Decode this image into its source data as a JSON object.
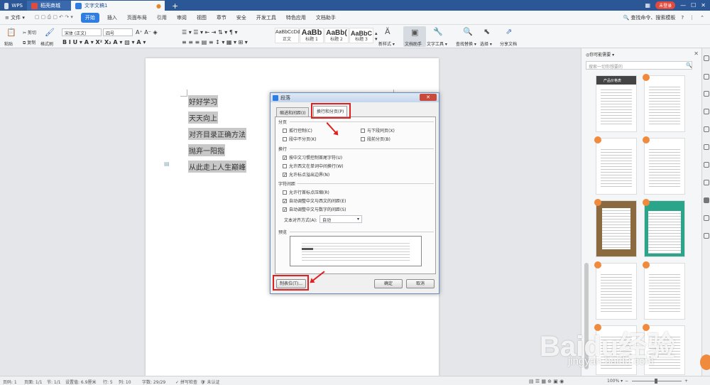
{
  "titlebar": {
    "tabs": [
      {
        "label": "WPS",
        "color": "#2b5797"
      },
      {
        "label": "稻壳商城",
        "color": "#e04b3d"
      },
      {
        "label": "文字文稿1",
        "color": "#2f7de1"
      }
    ],
    "login": "未登录"
  },
  "menubar": {
    "file": "文件",
    "items": [
      "开始",
      "插入",
      "页面布局",
      "引用",
      "审阅",
      "视图",
      "章节",
      "安全",
      "开发工具",
      "特色应用",
      "文档助手"
    ],
    "search": "查找命令、搜索模板"
  },
  "ribbon": {
    "paste": "粘贴",
    "cut": "剪切",
    "copy": "复制",
    "format_painter": "格式刷",
    "font": "宋体 (正文)",
    "size": "四号",
    "styles": [
      {
        "sample": "AaBbCcDd",
        "label": "正文"
      },
      {
        "sample": "AaBb",
        "label": "标题 1"
      },
      {
        "sample": "AaBb(",
        "label": "标题 2"
      },
      {
        "sample": "AaBbC",
        "label": "标题 3"
      }
    ],
    "new_style": "新样式",
    "doc_assistant": "文档助手",
    "text_tools": "文字工具",
    "find_replace": "查找替换",
    "select": "选择",
    "share": "分享文档"
  },
  "document": {
    "lines": [
      "好好学习",
      "天天向上",
      "对齐目录正确方法",
      "抛弃一阳指",
      "从此走上人生巅峰"
    ]
  },
  "dialog": {
    "title": "段落",
    "tab1": "缩进和间距(I)",
    "tab2": "换行和分页(P)",
    "sec_pagination": "分页",
    "opt_widow": "孤行控制(C)",
    "opt_keep_next": "与下段同页(X)",
    "opt_keep_lines": "段中不分页(K)",
    "opt_page_break": "段前分页(B)",
    "sec_linebreak": "换行",
    "opt_cjk_punct": "按中文习惯控制首尾字符(U)",
    "opt_west_word": "允许西文在单词中间换行(W)",
    "opt_punct_overflow": "允许标点溢出边界(N)",
    "sec_char_spacing": "字符间距",
    "opt_compress_punct": "允许行首标点压缩(R)",
    "opt_auto_cn_west": "自动调整中文与西文的间距(E)",
    "opt_auto_cn_num": "自动调整中文与数字的间距(S)",
    "text_align_label": "文本对齐方式(A):",
    "text_align_value": "自动",
    "sec_preview": "预览",
    "tabs_button": "制表位(T)...",
    "ok_button": "确定",
    "cancel_button": "取消",
    "checked": {
      "widow": false,
      "keep_next": false,
      "keep_lines": false,
      "page_break": false,
      "cjk_punct": true,
      "west_word": false,
      "punct_overflow": true,
      "compress_punct": false,
      "auto_cn_west": true,
      "auto_cn_num": true
    }
  },
  "rpanel": {
    "title": "你可能需要",
    "search_placeholder": "搜索一切你想要的",
    "thumb1_title": "产品价格表"
  },
  "status": {
    "page": "页码: 1",
    "pages": "页面: 1/1",
    "section": "节: 1/1",
    "setting": "设置值: 6.9厘米",
    "row": "行: 5",
    "col": "列: 10",
    "words": "字数: 29/29",
    "spell": "拼写检查",
    "cert": "未认证",
    "zoom": "100%"
  },
  "watermark": {
    "logo": "Baidu经验",
    "url": "jingyan.baidu.com"
  }
}
